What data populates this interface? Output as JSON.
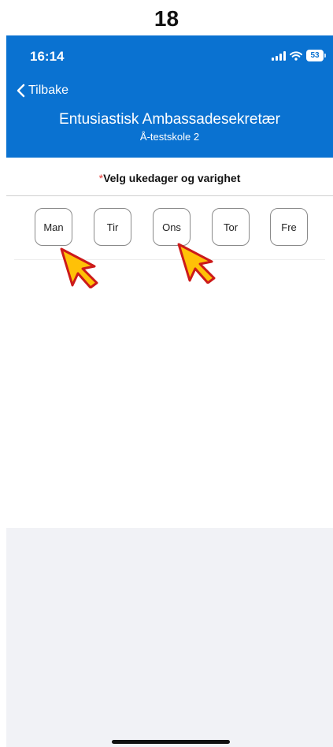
{
  "page_number": "18",
  "status_bar": {
    "time": "16:14",
    "battery": "53"
  },
  "nav": {
    "back_label": "Tilbake"
  },
  "header": {
    "title": "Entusiastisk Ambassadesekretær",
    "subtitle": "Å-testskole 2"
  },
  "section": {
    "required_marker": "*",
    "label": "Velg ukedager og varighet"
  },
  "days": [
    "Man",
    "Tir",
    "Ons",
    "Tor",
    "Fre"
  ],
  "colors": {
    "header_bg": "#0a72d1",
    "required": "#e53935",
    "cursor_fill": "#ffc107",
    "cursor_stroke": "#cc1a1a"
  }
}
